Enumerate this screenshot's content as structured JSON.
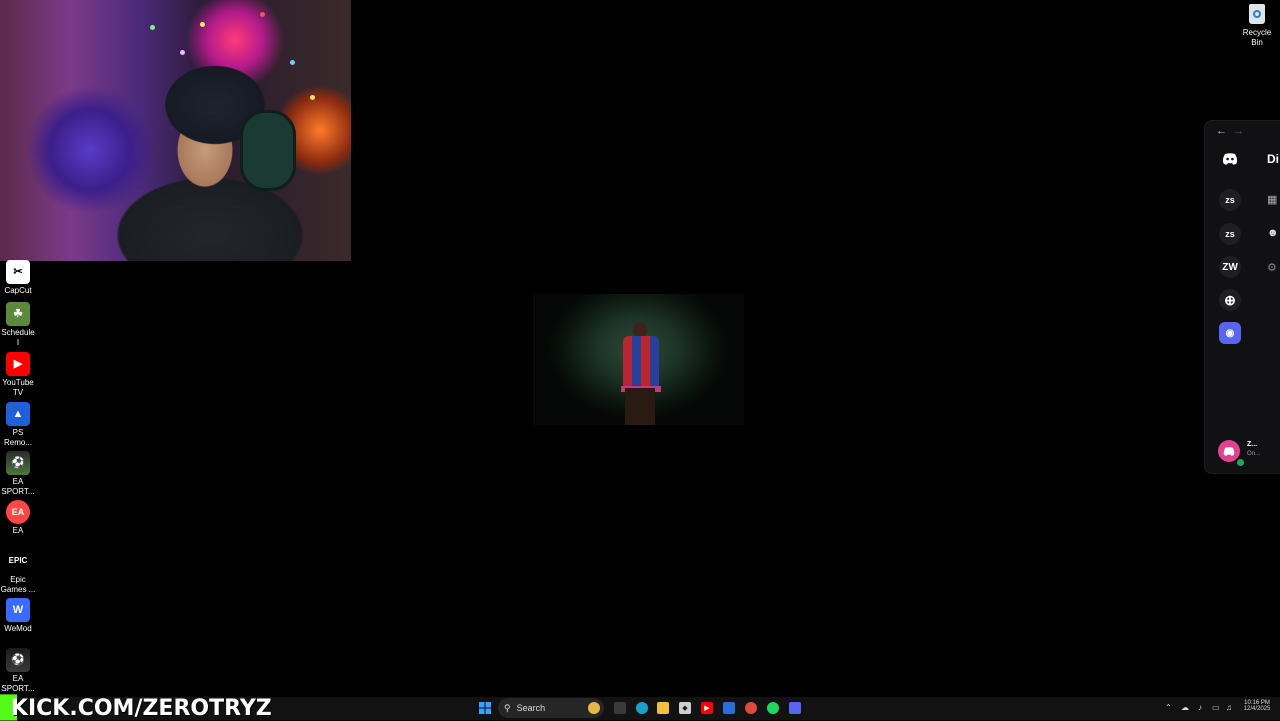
{
  "stream": {
    "channel_banner": "KICK.COM/ZEROTRYZ"
  },
  "desktop": {
    "recycle_bin": {
      "label": "Recycle Bin",
      "icon": "recycle-bin-icon"
    },
    "icons": [
      {
        "label": "CapCut",
        "icon": "capcut-icon"
      },
      {
        "label": "Schedule I",
        "icon": "schedule-one-icon"
      },
      {
        "label": "YouTube TV",
        "icon": "youtube-tv-icon"
      },
      {
        "label": "PS Remo...",
        "icon": "ps-remote-play-icon"
      },
      {
        "label": "EA SPORT...",
        "icon": "ea-sports-icon"
      },
      {
        "label": "EA",
        "icon": "ea-app-icon"
      },
      {
        "label": "Epic Games ...",
        "icon": "epic-games-icon",
        "glyph_text": "EPIC"
      },
      {
        "label": "WeMod",
        "icon": "wemod-icon",
        "glyph_text": "W"
      },
      {
        "label": "EA SPORT...",
        "icon": "ea-sports-icon"
      }
    ]
  },
  "discord": {
    "title_partial": "Di",
    "servers": [
      "zs",
      "zs",
      "ZW"
    ],
    "user": {
      "name": "Z...",
      "status": "On..."
    },
    "colors": {
      "accent": "#5865f2",
      "avatar": "#e0438f",
      "online": "#23a55a"
    }
  },
  "taskbar": {
    "search_label": "Search",
    "time": "10:16 PM",
    "date": "12/4/2025"
  }
}
